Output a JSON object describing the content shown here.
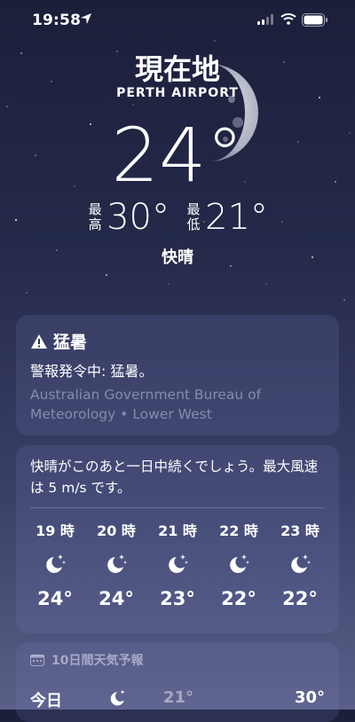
{
  "status": {
    "time": "19:58"
  },
  "header": {
    "city": "現在地",
    "location": "PERTH AIRPORT",
    "temperature": "24°",
    "high_label": "最\n高",
    "high": "30°",
    "low_label": "最\n低",
    "low": "21°",
    "condition": "快晴"
  },
  "alert": {
    "title": "猛暑",
    "message": "警報発令中: 猛暑。",
    "source": "Australian Government Bureau of Meteorology • Lower West"
  },
  "hourly": {
    "summary": "快晴がこのあと一日中続くでしょう。最大風速は 5 m/s です。",
    "items": [
      {
        "time": "19 時",
        "icon": "moon-stars-icon",
        "temp": "24°"
      },
      {
        "time": "20 時",
        "icon": "moon-stars-icon",
        "temp": "24°"
      },
      {
        "time": "21 時",
        "icon": "moon-stars-icon",
        "temp": "23°"
      },
      {
        "time": "22 時",
        "icon": "moon-stars-icon",
        "temp": "22°"
      },
      {
        "time": "23 時",
        "icon": "moon-stars-icon",
        "temp": "22°"
      }
    ]
  },
  "forecast": {
    "title": "10日間天気予報",
    "today": {
      "day": "今日",
      "low": "21°",
      "high": "30°"
    }
  }
}
